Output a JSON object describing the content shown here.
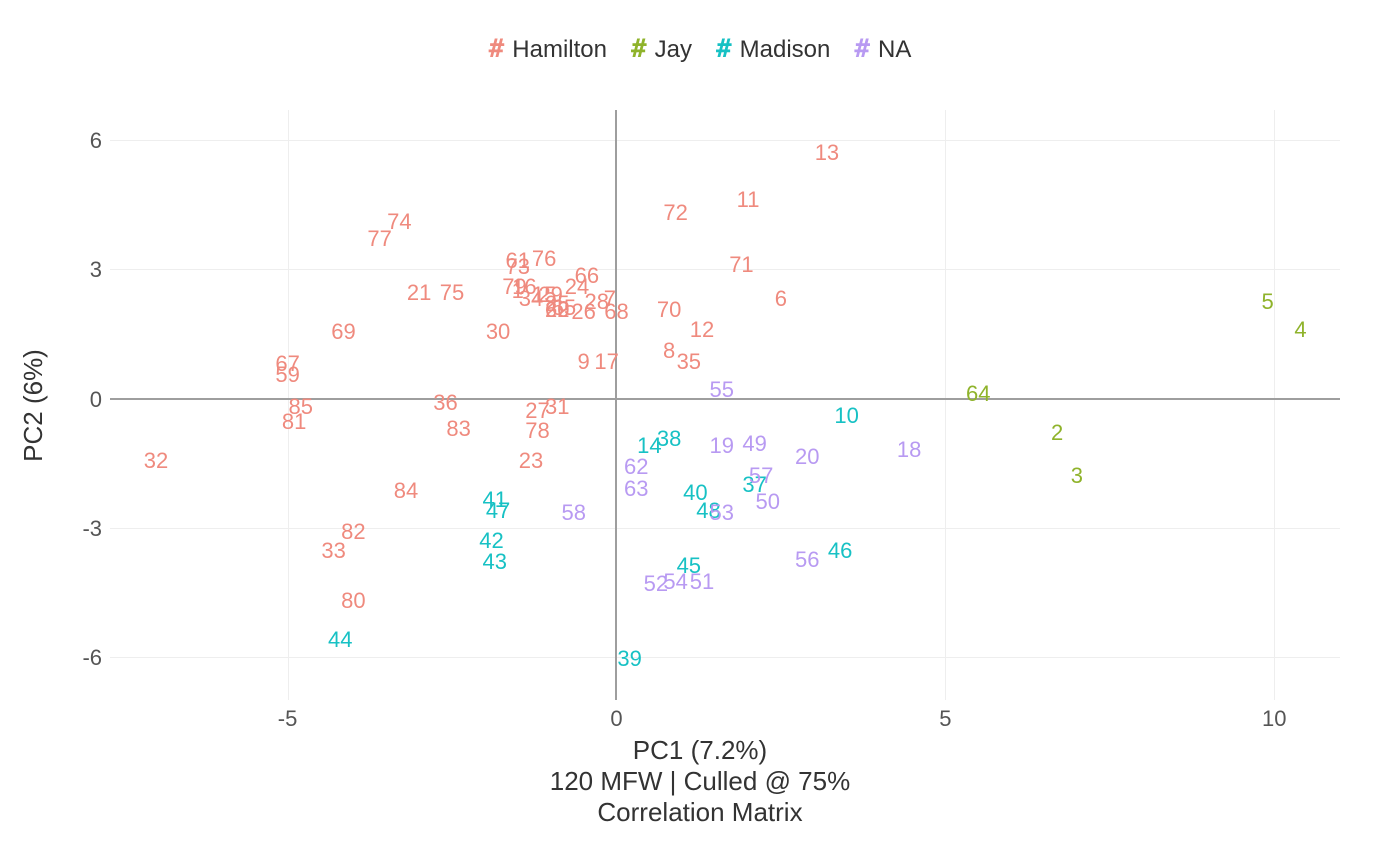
{
  "chart_data": {
    "type": "scatter",
    "title": "",
    "xlabel": "PC1 (7.2%)",
    "ylabel": "PC2 (6%)",
    "subtitle1": "120 MFW | Culled @ 75%",
    "subtitle2": "Correlation Matrix",
    "xlim": [
      -7.7,
      11.0
    ],
    "ylim": [
      -7.0,
      6.7
    ],
    "x_ticks": [
      -5,
      0,
      5,
      10
    ],
    "y_ticks": [
      -6,
      -3,
      0,
      3,
      6
    ],
    "legend": [
      {
        "name": "Hamilton",
        "color": "#ef8a7e",
        "symbol": "#"
      },
      {
        "name": "Jay",
        "color": "#8fb32b",
        "symbol": "#"
      },
      {
        "name": "Madison",
        "color": "#17c1c4",
        "symbol": "#"
      },
      {
        "name": "NA",
        "color": "#b89af2",
        "symbol": "#"
      }
    ],
    "series": [
      {
        "name": "Hamilton",
        "color": "#ef8a7e",
        "points": [
          {
            "label": "1",
            "x": -1.5,
            "y": 2.5
          },
          {
            "label": "6",
            "x": 2.5,
            "y": 2.3
          },
          {
            "label": "7",
            "x": -0.1,
            "y": 2.3
          },
          {
            "label": "8",
            "x": 0.8,
            "y": 1.1
          },
          {
            "label": "9",
            "x": -0.5,
            "y": 0.85
          },
          {
            "label": "11",
            "x": 2.0,
            "y": 4.6
          },
          {
            "label": "12",
            "x": 1.3,
            "y": 1.6
          },
          {
            "label": "13",
            "x": 3.2,
            "y": 5.7
          },
          {
            "label": "15",
            "x": -1.1,
            "y": 2.4
          },
          {
            "label": "16",
            "x": -1.4,
            "y": 2.6
          },
          {
            "label": "17",
            "x": -0.15,
            "y": 0.85
          },
          {
            "label": "21",
            "x": -3.0,
            "y": 2.45
          },
          {
            "label": "22",
            "x": -0.9,
            "y": 2.05
          },
          {
            "label": "23",
            "x": -1.3,
            "y": -1.45
          },
          {
            "label": "24",
            "x": -0.6,
            "y": 2.6
          },
          {
            "label": "25",
            "x": -0.9,
            "y": 2.2
          },
          {
            "label": "26",
            "x": -0.5,
            "y": 2.0
          },
          {
            "label": "27",
            "x": -1.2,
            "y": -0.3
          },
          {
            "label": "28",
            "x": -0.3,
            "y": 2.25
          },
          {
            "label": "29",
            "x": -1.0,
            "y": 2.4
          },
          {
            "label": "30",
            "x": -1.8,
            "y": 1.55
          },
          {
            "label": "31",
            "x": -0.9,
            "y": -0.2
          },
          {
            "label": "32",
            "x": -7.0,
            "y": -1.45
          },
          {
            "label": "33",
            "x": -4.3,
            "y": -3.55
          },
          {
            "label": "34",
            "x": -1.3,
            "y": 2.3
          },
          {
            "label": "35",
            "x": 1.1,
            "y": 0.85
          },
          {
            "label": "36",
            "x": -2.6,
            "y": -0.1
          },
          {
            "label": "59",
            "x": -5.0,
            "y": 0.55
          },
          {
            "label": "60",
            "x": -0.9,
            "y": 2.05
          },
          {
            "label": "61",
            "x": -1.5,
            "y": 3.2
          },
          {
            "label": "65",
            "x": -0.8,
            "y": 2.1
          },
          {
            "label": "66",
            "x": -0.45,
            "y": 2.85
          },
          {
            "label": "67",
            "x": -5.0,
            "y": 0.8
          },
          {
            "label": "68",
            "x": 0.0,
            "y": 2.0
          },
          {
            "label": "69",
            "x": -4.15,
            "y": 1.55
          },
          {
            "label": "70",
            "x": 0.8,
            "y": 2.05
          },
          {
            "label": "71",
            "x": 1.9,
            "y": 3.1
          },
          {
            "label": "72",
            "x": 0.9,
            "y": 4.3
          },
          {
            "label": "73",
            "x": -1.5,
            "y": 3.05
          },
          {
            "label": "74",
            "x": -3.3,
            "y": 4.1
          },
          {
            "label": "75",
            "x": -2.5,
            "y": 2.45
          },
          {
            "label": "76",
            "x": -1.1,
            "y": 3.25
          },
          {
            "label": "77",
            "x": -3.6,
            "y": 3.7
          },
          {
            "label": "78",
            "x": -1.2,
            "y": -0.75
          },
          {
            "label": "79",
            "x": -1.55,
            "y": 2.6
          },
          {
            "label": "80",
            "x": -4.0,
            "y": -4.7
          },
          {
            "label": "81",
            "x": -4.9,
            "y": -0.55
          },
          {
            "label": "82",
            "x": -4.0,
            "y": -3.1
          },
          {
            "label": "83",
            "x": -2.4,
            "y": -0.7
          },
          {
            "label": "84",
            "x": -3.2,
            "y": -2.15
          },
          {
            "label": "85",
            "x": -4.8,
            "y": -0.2
          }
        ]
      },
      {
        "name": "Jay",
        "color": "#8fb32b",
        "points": [
          {
            "label": "2",
            "x": 6.7,
            "y": -0.8
          },
          {
            "label": "3",
            "x": 7.0,
            "y": -1.8
          },
          {
            "label": "4",
            "x": 10.4,
            "y": 1.6
          },
          {
            "label": "5",
            "x": 9.9,
            "y": 2.25
          },
          {
            "label": "64",
            "x": 5.5,
            "y": 0.1
          }
        ]
      },
      {
        "name": "Madison",
        "color": "#17c1c4",
        "points": [
          {
            "label": "10",
            "x": 3.5,
            "y": -0.4
          },
          {
            "label": "14",
            "x": 0.5,
            "y": -1.1
          },
          {
            "label": "37",
            "x": 2.1,
            "y": -2.0
          },
          {
            "label": "38",
            "x": 0.8,
            "y": -0.95
          },
          {
            "label": "39",
            "x": 0.2,
            "y": -6.05
          },
          {
            "label": "40",
            "x": 1.2,
            "y": -2.2
          },
          {
            "label": "41",
            "x": -1.85,
            "y": -2.35
          },
          {
            "label": "42",
            "x": -1.9,
            "y": -3.3
          },
          {
            "label": "43",
            "x": -1.85,
            "y": -3.8
          },
          {
            "label": "44",
            "x": -4.2,
            "y": -5.6
          },
          {
            "label": "45",
            "x": 1.1,
            "y": -3.9
          },
          {
            "label": "46",
            "x": 3.4,
            "y": -3.55
          },
          {
            "label": "47",
            "x": -1.8,
            "y": -2.6
          },
          {
            "label": "48",
            "x": 1.4,
            "y": -2.6
          }
        ]
      },
      {
        "name": "NA",
        "color": "#b89af2",
        "points": [
          {
            "label": "18",
            "x": 4.45,
            "y": -1.2
          },
          {
            "label": "19",
            "x": 1.6,
            "y": -1.1
          },
          {
            "label": "20",
            "x": 2.9,
            "y": -1.35
          },
          {
            "label": "49",
            "x": 2.1,
            "y": -1.05
          },
          {
            "label": "50",
            "x": 2.3,
            "y": -2.4
          },
          {
            "label": "51",
            "x": 1.3,
            "y": -4.25
          },
          {
            "label": "52",
            "x": 0.6,
            "y": -4.3
          },
          {
            "label": "53",
            "x": 1.6,
            "y": -2.65
          },
          {
            "label": "54",
            "x": 0.9,
            "y": -4.25
          },
          {
            "label": "55",
            "x": 1.6,
            "y": 0.2
          },
          {
            "label": "56",
            "x": 2.9,
            "y": -3.75
          },
          {
            "label": "57",
            "x": 2.2,
            "y": -1.8
          },
          {
            "label": "58",
            "x": -0.65,
            "y": -2.65
          },
          {
            "label": "62",
            "x": 0.3,
            "y": -1.6
          },
          {
            "label": "63",
            "x": 0.3,
            "y": -2.1
          }
        ]
      }
    ]
  }
}
